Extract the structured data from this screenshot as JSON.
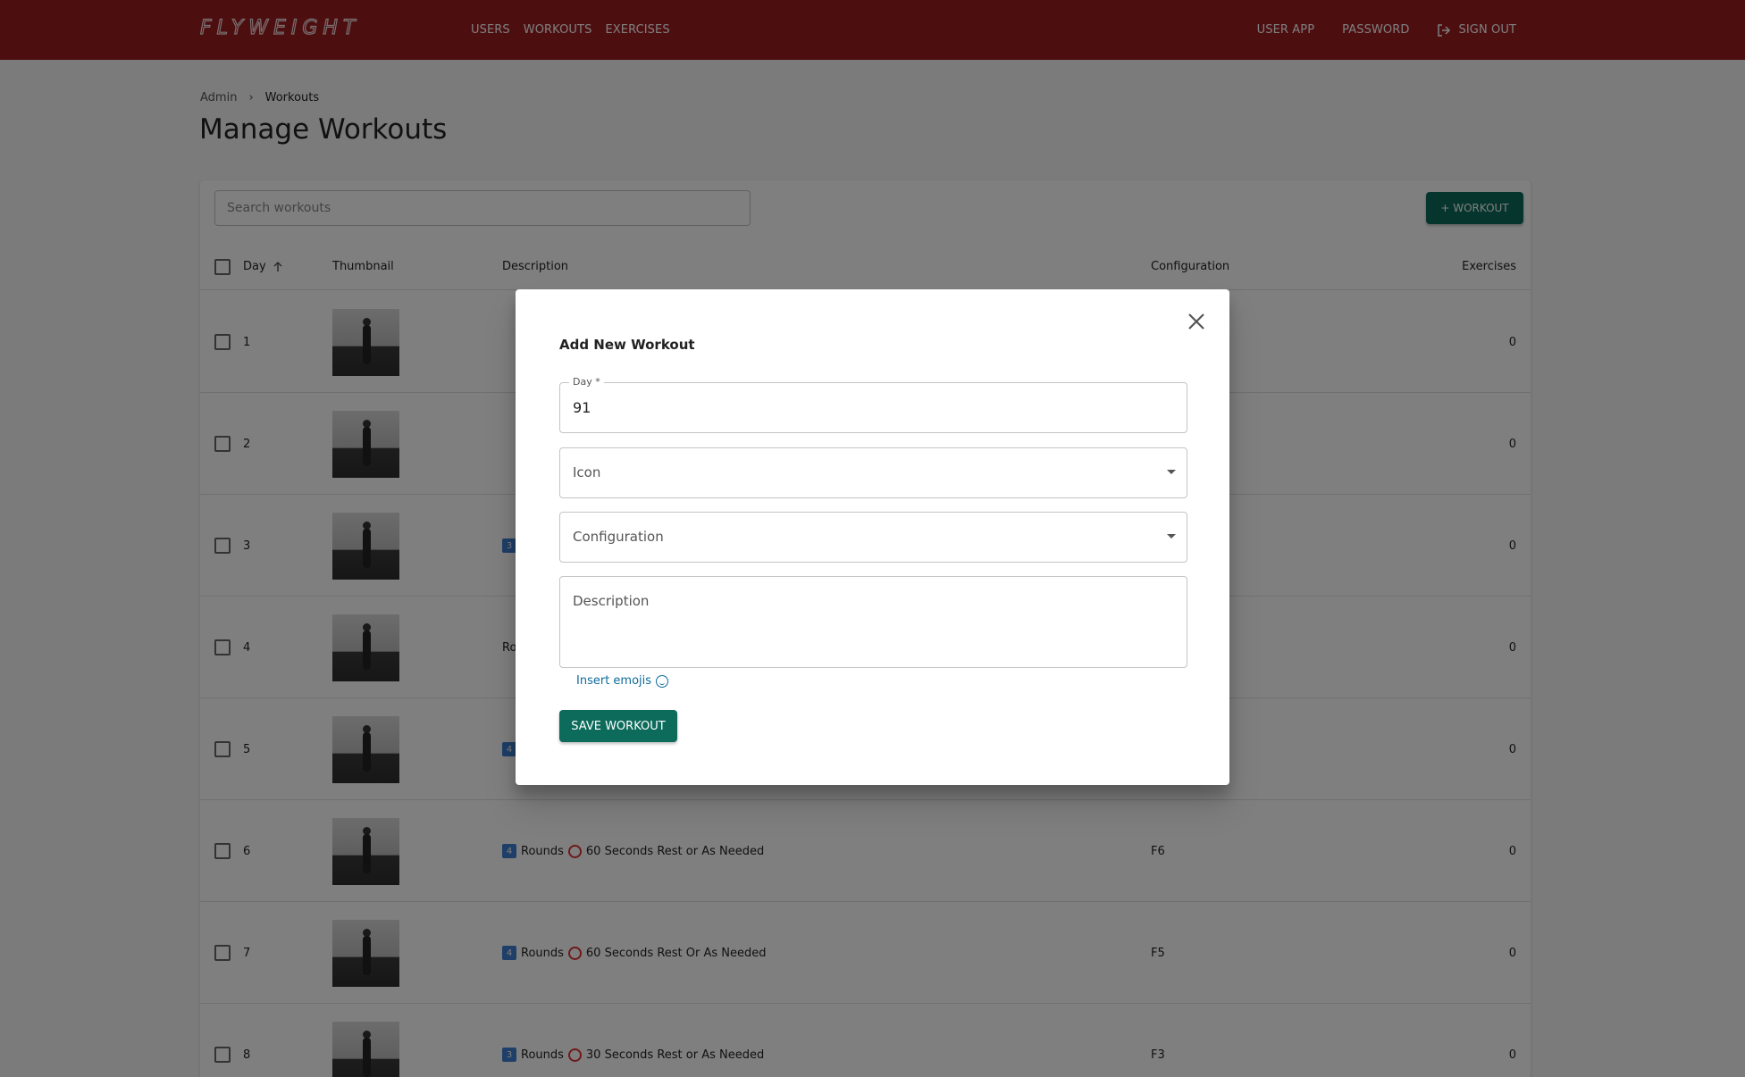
{
  "header": {
    "logo_text": "FLYWEIGHT",
    "nav_left": [
      "USERS",
      "WORKOUTS",
      "EXERCISES"
    ],
    "nav_right": [
      "USER APP",
      "PASSWORD",
      "SIGN OUT"
    ],
    "accent_color": "#9b1c20"
  },
  "breadcrumb": {
    "root": "Admin",
    "current": "Workouts"
  },
  "page": {
    "title": "Manage Workouts"
  },
  "toolbar": {
    "search_placeholder": "Search workouts",
    "add_label": "+ WORKOUT"
  },
  "table": {
    "columns": [
      "Day",
      "Thumbnail",
      "Description",
      "Configuration",
      "Exercises"
    ],
    "sort_column": "Day",
    "rows": [
      {
        "day": "1",
        "badge": "",
        "description": "",
        "configuration": "",
        "exercises": "0"
      },
      {
        "day": "2",
        "badge": "",
        "description": "",
        "configuration": "",
        "exercises": "0"
      },
      {
        "day": "3",
        "badge": "3",
        "description": "",
        "configuration": "",
        "exercises": "0"
      },
      {
        "day": "4",
        "badge": "",
        "description": "Ro",
        "configuration": "",
        "exercises": "0"
      },
      {
        "day": "5",
        "badge": "4",
        "description": "",
        "configuration": "",
        "exercises": "0"
      },
      {
        "day": "6",
        "badge": "4",
        "description_rounds": "Rounds",
        "description": "60 Seconds Rest or As Needed",
        "configuration": "F6",
        "exercises": "0"
      },
      {
        "day": "7",
        "badge": "4",
        "description_rounds": "Rounds",
        "description": "60 Seconds Rest Or As Needed",
        "configuration": "F5",
        "exercises": "0"
      },
      {
        "day": "8",
        "badge": "3",
        "description_rounds": "Rounds",
        "description": "30 Seconds Rest or As Needed",
        "configuration": "F3",
        "exercises": "0"
      }
    ]
  },
  "modal": {
    "title": "Add New Workout",
    "day_label": "Day *",
    "day_value": "91",
    "icon_placeholder": "Icon",
    "configuration_placeholder": "Configuration",
    "description_placeholder": "Description",
    "emoji_link": "Insert emojis",
    "save_label": "SAVE WORKOUT",
    "button_color": "#0d6b5b"
  }
}
